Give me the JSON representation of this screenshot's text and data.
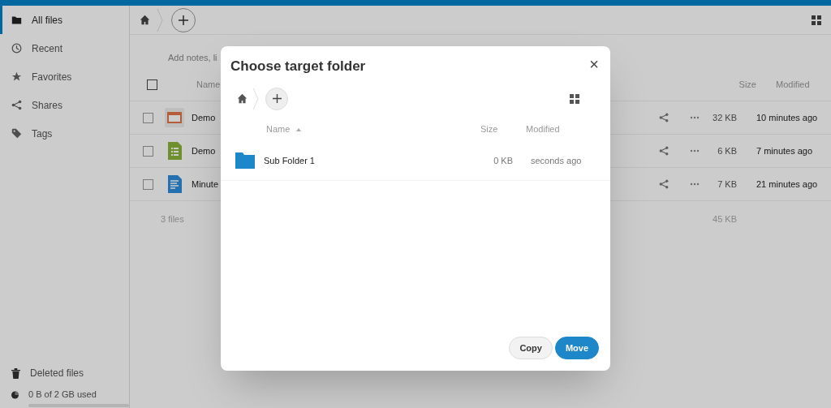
{
  "sidebar": {
    "items": [
      {
        "label": "All files",
        "selected": true
      },
      {
        "label": "Recent",
        "selected": false
      },
      {
        "label": "Favorites",
        "selected": false
      },
      {
        "label": "Shares",
        "selected": false
      },
      {
        "label": "Tags",
        "selected": false
      }
    ],
    "deleted_files": "Deleted files",
    "quota": {
      "label": "0 B of 2 GB used"
    }
  },
  "files": {
    "notes_placeholder": "Add notes, li",
    "select_all_checked": false,
    "columns": {
      "name": "Name",
      "size": "Size",
      "modified": "Modified"
    },
    "rows": [
      {
        "name": "Demo",
        "kind": "presentation",
        "size": "32 KB",
        "modified": "10 minutes ago",
        "checked": false
      },
      {
        "name": "Demo",
        "kind": "spreadsheet",
        "size": "6 KB",
        "modified": "7 minutes ago",
        "checked": false
      },
      {
        "name": "Minute",
        "kind": "document",
        "size": "7 KB",
        "modified": "21 minutes ago",
        "checked": false
      }
    ],
    "summary": {
      "count": "3 files",
      "size": "45 KB"
    }
  },
  "dialog": {
    "title": "Choose target folder",
    "close": "×",
    "columns": {
      "name": "Name",
      "size": "Size",
      "modified": "Modified"
    },
    "rows": [
      {
        "name": "Sub Folder 1",
        "size": "0 KB",
        "modified": "seconds ago"
      }
    ],
    "buttons": [
      {
        "label": "Copy",
        "kind": "secondary"
      },
      {
        "label": "Move",
        "kind": "primary"
      }
    ]
  }
}
